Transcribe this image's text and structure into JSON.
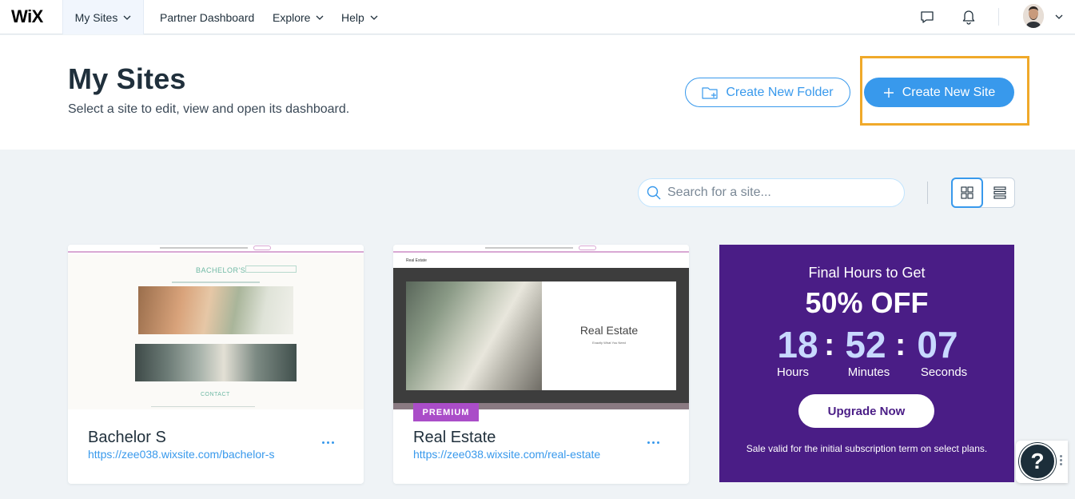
{
  "topbar": {
    "logo": "WiX",
    "nav": [
      {
        "label": "My Sites"
      },
      {
        "label": "Partner Dashboard"
      },
      {
        "label": "Explore"
      },
      {
        "label": "Help"
      }
    ],
    "icons": [
      "chat-icon",
      "bell-icon",
      "avatar",
      "chevron-down-icon"
    ]
  },
  "header": {
    "title": "My Sites",
    "subtitle": "Select a site to edit, view and open its dashboard.",
    "create_folder_label": "Create New Folder",
    "create_site_label": "Create New Site"
  },
  "toolbar": {
    "search_placeholder": "Search for a site...",
    "views": [
      "grid-view-icon",
      "list-view-icon"
    ],
    "active_view": "grid"
  },
  "sites": [
    {
      "name": "Bachelor S",
      "url": "https://zee038.wixsite.com/bachelor-s",
      "thumb": {
        "brand": "BACHELOR'S",
        "section": "CONTACT"
      }
    },
    {
      "name": "Real Estate",
      "url": "https://zee038.wixsite.com/real-estate",
      "badge": "PREMIUM",
      "thumb": {
        "header": "Real Estate",
        "title": "Real Estate",
        "subtitle": "Exactly What You Need"
      }
    }
  ],
  "promo": {
    "line1": "Final Hours to Get",
    "line2": "50% OFF",
    "hours": "18",
    "minutes": "52",
    "seconds": "07",
    "hours_label": "Hours",
    "minutes_label": "Minutes",
    "seconds_label": "Seconds",
    "cta": "Upgrade Now",
    "note": "Sale valid for the initial subscription term on select plans."
  },
  "help": {
    "label": "?"
  },
  "colors": {
    "accent": "#3899ec",
    "promo_bg": "#4a1d86",
    "premium": "#aa4dc8",
    "highlight": "#f0a92a"
  }
}
